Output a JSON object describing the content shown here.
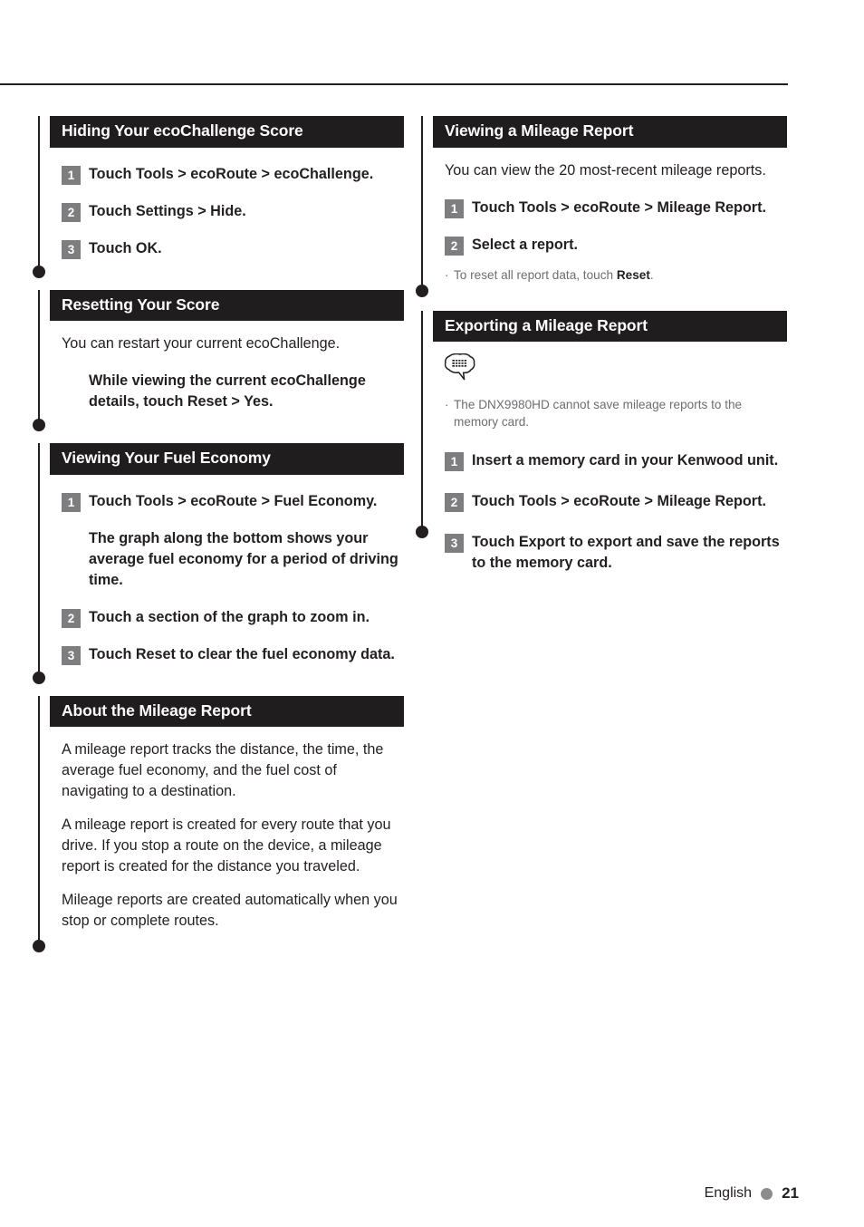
{
  "page": {
    "footer": {
      "language": "English",
      "page_number": "21",
      "dot_color": "#8c8c8e"
    },
    "colors": {
      "header_bar": "#1f1d1e",
      "step_badge": "#7e7e80",
      "body_text": "#231f20",
      "note_text": "#6d6e71"
    }
  },
  "left_column": {
    "sections": [
      {
        "title": "Hiding Your ecoChallenge Score",
        "blocks": [
          {
            "kind": "step",
            "num": "1",
            "text": "Touch Tools > ecoRoute > ecoChallenge."
          },
          {
            "kind": "step",
            "num": "2",
            "text": "Touch Settings > Hide."
          },
          {
            "kind": "step",
            "num": "3",
            "text": "Touch OK."
          }
        ]
      },
      {
        "title": "Resetting Your Score",
        "blocks": [
          {
            "kind": "para",
            "text": "You can restart your current ecoChallenge."
          },
          {
            "kind": "substep",
            "text": "While viewing the current ecoChallenge details, touch Reset > Yes."
          }
        ]
      },
      {
        "title": "Viewing Your Fuel Economy",
        "blocks": [
          {
            "kind": "step",
            "num": "1",
            "text": "Touch Tools > ecoRoute > Fuel Economy."
          },
          {
            "kind": "substep",
            "text": "The graph along the bottom shows your average fuel economy for a period of driving time."
          },
          {
            "kind": "step",
            "num": "2",
            "text": "Touch a section of the graph to zoom in."
          },
          {
            "kind": "step",
            "num": "3",
            "text": "Touch Reset to clear the fuel economy data."
          }
        ]
      },
      {
        "title": "About the Mileage Report",
        "blocks": [
          {
            "kind": "para",
            "text": "A mileage report tracks the distance, the time, the average fuel economy, and the fuel cost of navigating to a destination."
          },
          {
            "kind": "para",
            "text": "A mileage report is created for every route that you drive. If you stop a route on the device, a mileage report is created for the distance you traveled."
          },
          {
            "kind": "para",
            "text": "Mileage reports are created automatically when you stop or complete routes."
          }
        ]
      }
    ]
  },
  "right_column": {
    "sections": [
      {
        "title": "Viewing a Mileage Report",
        "blocks": [
          {
            "kind": "para",
            "text": "You can view the 20 most-recent mileage reports."
          },
          {
            "kind": "step",
            "num": "1",
            "text": "Touch Tools > ecoRoute > Mileage Report."
          },
          {
            "kind": "step",
            "num": "2",
            "text": "Select a report."
          },
          {
            "kind": "note",
            "bullet": "·",
            "text_before": "To reset all report data, touch ",
            "text_bold": "Reset",
            "text_after": "."
          }
        ]
      },
      {
        "title": "Exporting a Mileage Report",
        "blocks": [
          {
            "kind": "note_icon",
            "icon": "note-speech-bubble-icon"
          },
          {
            "kind": "note",
            "bullet": "·",
            "text_before": "The DNX9980HD cannot save mileage reports to the memory card.",
            "text_bold": "",
            "text_after": ""
          },
          {
            "kind": "step",
            "num": "1",
            "text": "Insert a memory card in your Kenwood unit."
          },
          {
            "kind": "step",
            "num": "2",
            "text": "Touch Tools > ecoRoute > Mileage Report."
          },
          {
            "kind": "step",
            "num": "3",
            "text": "Touch Export to export and save the reports to the memory card."
          }
        ]
      }
    ]
  }
}
